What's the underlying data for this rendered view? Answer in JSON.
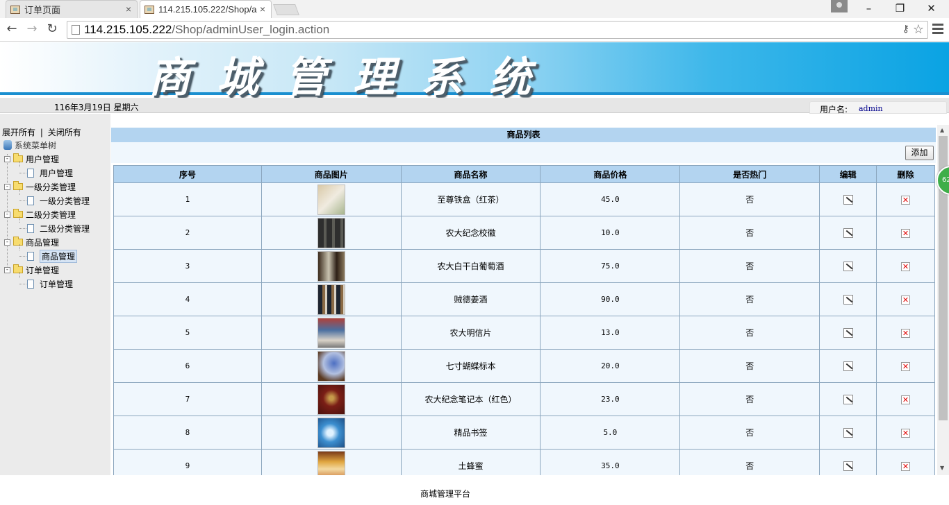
{
  "browser": {
    "tabs": [
      {
        "title": "订单页面",
        "active": false
      },
      {
        "title": "114.215.105.222/Shop/a",
        "active": true
      }
    ],
    "url_host": "114.215.105.222",
    "url_path": "/Shop/adminUser_login.action"
  },
  "header": {
    "banner_title": "商城管理系统",
    "date": "116年3月19日 星期六",
    "user_label": "用户名:",
    "user_name": "admin"
  },
  "sidebar": {
    "expand_all": "展开所有",
    "separator": "|",
    "collapse_all": "关闭所有",
    "root": "系统菜单树",
    "groups": [
      {
        "label": "用户管理",
        "child": "用户管理"
      },
      {
        "label": "一级分类管理",
        "child": "一级分类管理"
      },
      {
        "label": "二级分类管理",
        "child": "二级分类管理"
      },
      {
        "label": "商品管理",
        "child": "商品管理",
        "selected": true
      },
      {
        "label": "订单管理",
        "child": "订单管理"
      }
    ]
  },
  "main": {
    "list_title": "商品列表",
    "add_button": "添加",
    "columns": [
      "序号",
      "商品图片",
      "商品名称",
      "商品价格",
      "是否热门",
      "编辑",
      "删除"
    ],
    "rows": [
      {
        "no": "1",
        "name": "至尊铁盒（红茶）",
        "price": "45.0",
        "hot": "否"
      },
      {
        "no": "2",
        "name": "农大纪念校徽",
        "price": "10.0",
        "hot": "否"
      },
      {
        "no": "3",
        "name": "农大白干白葡萄酒",
        "price": "75.0",
        "hot": "否"
      },
      {
        "no": "4",
        "name": "贼德姜酒",
        "price": "90.0",
        "hot": "否"
      },
      {
        "no": "5",
        "name": "农大明信片",
        "price": "13.0",
        "hot": "否"
      },
      {
        "no": "6",
        "name": "七寸蝴蝶标本",
        "price": "20.0",
        "hot": "否"
      },
      {
        "no": "7",
        "name": "农大纪念笔记本（红色）",
        "price": "23.0",
        "hot": "否"
      },
      {
        "no": "8",
        "name": "精品书签",
        "price": "5.0",
        "hot": "否"
      },
      {
        "no": "9",
        "name": "土蜂蜜",
        "price": "35.0",
        "hot": "否"
      }
    ]
  },
  "widget": {
    "text": "62"
  },
  "footer": {
    "text": "商城管理平台"
  },
  "colors": {
    "header_blue": "#b3d4f0",
    "row_bg": "#f0f7fd",
    "banner_edge": "#1a8fd0",
    "user_name": "#00008b"
  }
}
